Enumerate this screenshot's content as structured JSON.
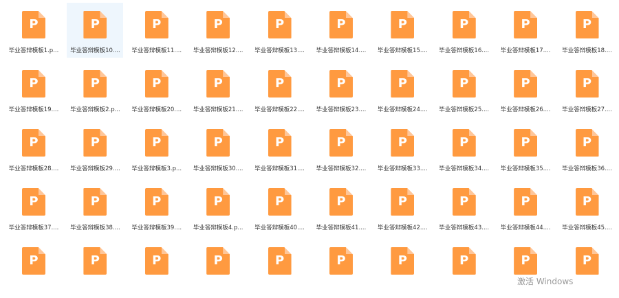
{
  "watermark": "激活 Windows",
  "files": [
    {
      "name": "毕业答辩模板1.p...",
      "selected": false
    },
    {
      "name": "毕业答辩模板10....",
      "selected": true
    },
    {
      "name": "毕业答辩模板11....",
      "selected": false
    },
    {
      "name": "毕业答辩模板12....",
      "selected": false
    },
    {
      "name": "毕业答辩模板13....",
      "selected": false
    },
    {
      "name": "毕业答辩模板14....",
      "selected": false
    },
    {
      "name": "毕业答辩模板15....",
      "selected": false
    },
    {
      "name": "毕业答辩模板16....",
      "selected": false
    },
    {
      "name": "毕业答辩模板17....",
      "selected": false
    },
    {
      "name": "毕业答辩模板18....",
      "selected": false
    },
    {
      "name": "毕业答辩模板19....",
      "selected": false
    },
    {
      "name": "毕业答辩模板2.p...",
      "selected": false
    },
    {
      "name": "毕业答辩模板20....",
      "selected": false
    },
    {
      "name": "毕业答辩模板21....",
      "selected": false
    },
    {
      "name": "毕业答辩模板22....",
      "selected": false
    },
    {
      "name": "毕业答辩模板23....",
      "selected": false
    },
    {
      "name": "毕业答辩模板24....",
      "selected": false
    },
    {
      "name": "毕业答辩模板25....",
      "selected": false
    },
    {
      "name": "毕业答辩模板26....",
      "selected": false
    },
    {
      "name": "毕业答辩模板27....",
      "selected": false
    },
    {
      "name": "毕业答辩模板28....",
      "selected": false
    },
    {
      "name": "毕业答辩模板29....",
      "selected": false
    },
    {
      "name": "毕业答辩模板3.p...",
      "selected": false
    },
    {
      "name": "毕业答辩模板30....",
      "selected": false
    },
    {
      "name": "毕业答辩模板31....",
      "selected": false
    },
    {
      "name": "毕业答辩模板32....",
      "selected": false
    },
    {
      "name": "毕业答辩模板33....",
      "selected": false
    },
    {
      "name": "毕业答辩模板34....",
      "selected": false
    },
    {
      "name": "毕业答辩模板35....",
      "selected": false
    },
    {
      "name": "毕业答辩模板36....",
      "selected": false
    },
    {
      "name": "毕业答辩模板37....",
      "selected": false
    },
    {
      "name": "毕业答辩模板38....",
      "selected": false
    },
    {
      "name": "毕业答辩模板39....",
      "selected": false
    },
    {
      "name": "毕业答辩模板4.p...",
      "selected": false
    },
    {
      "name": "毕业答辩模板40....",
      "selected": false
    },
    {
      "name": "毕业答辩模板41....",
      "selected": false
    },
    {
      "name": "毕业答辩模板42....",
      "selected": false
    },
    {
      "name": "毕业答辩模板43....",
      "selected": false
    },
    {
      "name": "毕业答辩模板44....",
      "selected": false
    },
    {
      "name": "毕业答辩模板45....",
      "selected": false
    },
    {
      "name": "",
      "selected": false
    },
    {
      "name": "",
      "selected": false
    },
    {
      "name": "",
      "selected": false
    },
    {
      "name": "",
      "selected": false
    },
    {
      "name": "",
      "selected": false
    },
    {
      "name": "",
      "selected": false
    },
    {
      "name": "",
      "selected": false
    },
    {
      "name": "",
      "selected": false
    },
    {
      "name": "",
      "selected": false
    },
    {
      "name": "",
      "selected": false
    }
  ],
  "icon": {
    "name": "ppt-file-icon",
    "letter": "P",
    "color": "#ff9a40",
    "fold_color": "#ffc699"
  },
  "colors": {
    "selection": "#eef6fd",
    "text": "#333333",
    "watermark": "#9a9a9a"
  }
}
